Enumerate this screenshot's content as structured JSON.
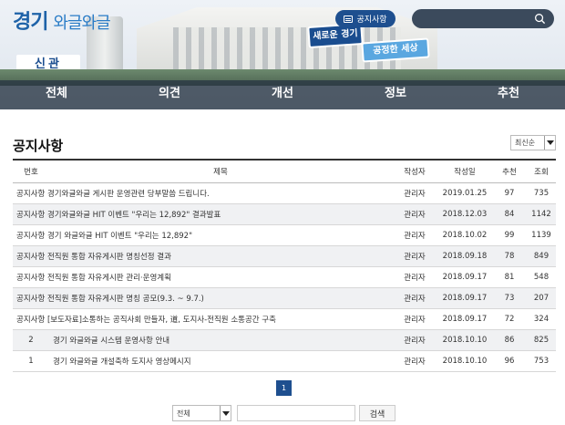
{
  "header": {
    "logo_main": "경기",
    "logo_sub": "와글와글",
    "notice_button": "공지사항",
    "search_placeholder": "",
    "banner_left_sign": "신관",
    "banner1": "새로운 경기",
    "banner2": "공정한 세상"
  },
  "nav": {
    "items": [
      "전체",
      "의견",
      "개선",
      "정보",
      "추천"
    ]
  },
  "page_title": "공지사항",
  "sort": {
    "selected": "최신순"
  },
  "table": {
    "headers": [
      "번호",
      "제목",
      "작성자",
      "작성일",
      "추천",
      "조회"
    ],
    "rows": [
      {
        "num": "",
        "subject": "공지사항 경기와글와글 게시판 운영관련 당부말씀 드립니다.",
        "author": "관리자",
        "date": "2019.01.25",
        "rec": "97",
        "views": "735"
      },
      {
        "num": "",
        "subject": "공지사항 경기와글와글 HIT 이벤트 \"우리는 12,892\" 결과발표",
        "author": "관리자",
        "date": "2018.12.03",
        "rec": "84",
        "views": "1142"
      },
      {
        "num": "",
        "subject": "공지사항 경기 와글와글 HIT 이벤트 \"우리는 12,892\"",
        "author": "관리자",
        "date": "2018.10.02",
        "rec": "99",
        "views": "1139"
      },
      {
        "num": "",
        "subject": "공지사항 전직원 통합 자유게시판 명칭선정 결과",
        "author": "관리자",
        "date": "2018.09.18",
        "rec": "78",
        "views": "849"
      },
      {
        "num": "",
        "subject": "공지사항 전직원 통합 자유게시판 관리·운영계획",
        "author": "관리자",
        "date": "2018.09.17",
        "rec": "81",
        "views": "548"
      },
      {
        "num": "",
        "subject": "공지사항 전직원 통합 자유게시판 명칭 공모(9.3. ~ 9.7.)",
        "author": "관리자",
        "date": "2018.09.17",
        "rec": "73",
        "views": "207"
      },
      {
        "num": "",
        "subject": "공지사항 [보도자료]소통하는 공직사회 만들자, 道, 도지사-전직원 소통공간 구축",
        "author": "관리자",
        "date": "2018.09.17",
        "rec": "72",
        "views": "324"
      },
      {
        "num": "2",
        "subject": "경기 와글와글 시스템 운영사항 안내",
        "author": "관리자",
        "date": "2018.10.10",
        "rec": "86",
        "views": "825"
      },
      {
        "num": "1",
        "subject": "경기 와글와글 개설축하 도지사 영상메시지",
        "author": "관리자",
        "date": "2018.10.10",
        "rec": "96",
        "views": "753"
      }
    ]
  },
  "pagination": {
    "current": "1"
  },
  "footer_search": {
    "select_value": "전체",
    "input_value": "",
    "button_label": "검색"
  },
  "colors": {
    "brand": "#1e4f8f",
    "logo": "#1e62a8"
  }
}
